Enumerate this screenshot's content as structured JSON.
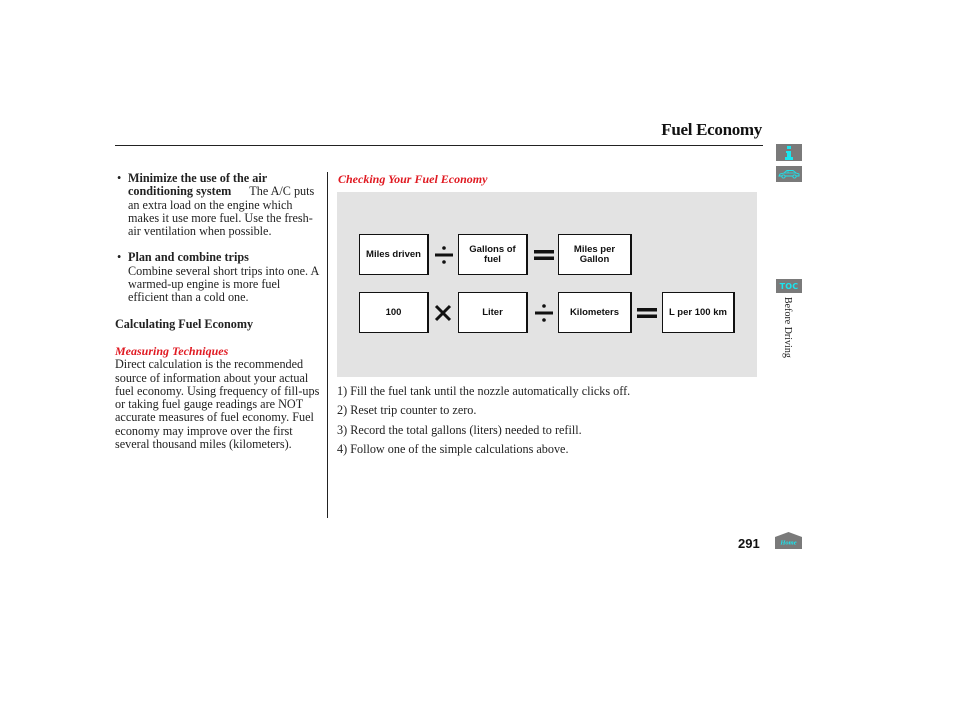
{
  "header": {
    "title": "Fuel Economy"
  },
  "nav": {
    "info_icon": "info-icon",
    "car_icon": "car-icon",
    "toc_label": "TOC",
    "section_label": "Before Driving",
    "home_label": "Home",
    "accent_color": "#19e6f0",
    "button_color": "#7a7a7a"
  },
  "left_column": {
    "bullets": [
      {
        "bold": "Minimize the use of the air conditioning system",
        "text": "The A/C puts an extra load on the engine which makes it use more fuel. Use the fresh-air ventilation when possible."
      },
      {
        "bold": "Plan and combine trips",
        "text": "Combine several short trips into one. A warmed-up engine is more fuel efficient than a cold one."
      }
    ],
    "calc_heading": "Calculating Fuel Economy",
    "subheading": "Measuring Techniques",
    "body": "Direct calculation is the recommended source of information about your actual fuel economy. Using frequency of fill-ups or taking fuel gauge readings are NOT accurate measures of fuel economy. Fuel economy may improve over the first several thousand miles (kilometers)."
  },
  "right_column": {
    "heading": "Checking Your Fuel Economy",
    "heading_color": "#e01a22",
    "formula_us": {
      "terms": [
        "Miles driven",
        "Gallons of fuel",
        "Miles per Gallon"
      ],
      "operators": [
        "divide",
        "equals"
      ]
    },
    "formula_metric": {
      "terms": [
        "100",
        "Liter",
        "Kilometers",
        "L per 100 km"
      ],
      "operators": [
        "multiply",
        "divide",
        "equals"
      ]
    },
    "steps": [
      "1) Fill the fuel tank until the nozzle automatically clicks off.",
      "2) Reset trip counter to zero.",
      "3) Record the total gallons (liters) needed to refill.",
      "4) Follow one of the simple calculations above."
    ]
  },
  "footer": {
    "page_number": "291"
  }
}
